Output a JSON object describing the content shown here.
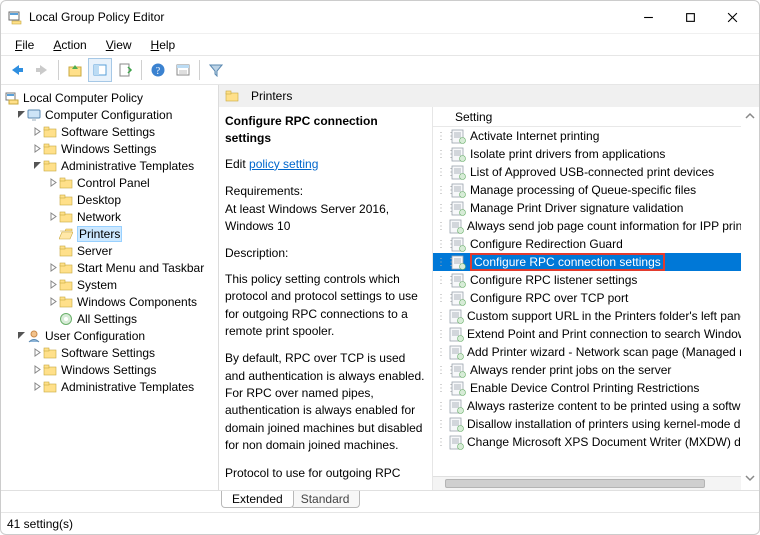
{
  "title": "Local Group Policy Editor",
  "menus": {
    "file": "File",
    "action": "Action",
    "view": "View",
    "help": "Help"
  },
  "tree": {
    "root": "Local Computer Policy",
    "cc": "Computer Configuration",
    "cc_software": "Software Settings",
    "cc_windows": "Windows Settings",
    "cc_admin": "Administrative Templates",
    "at_control_panel": "Control Panel",
    "at_desktop": "Desktop",
    "at_network": "Network",
    "at_printers": "Printers",
    "at_server": "Server",
    "at_start": "Start Menu and Taskbar",
    "at_system": "System",
    "at_wcomp": "Windows Components",
    "at_allsettings": "All Settings",
    "uc": "User Configuration",
    "uc_software": "Software Settings",
    "uc_windows": "Windows Settings",
    "uc_admin": "Administrative Templates"
  },
  "right_header": "Printers",
  "desc": {
    "title": "Configure RPC connection settings",
    "edit_prefix": "Edit ",
    "edit_link": "policy setting ",
    "reqs_heading": "Requirements:",
    "reqs_body": "At least Windows Server 2016, Windows 10",
    "desc_heading": "Description:",
    "p1": "This policy setting controls which protocol and protocol settings to use for outgoing RPC connections to a remote print spooler.",
    "p2": "By default, RPC over TCP is used and authentication is always enabled. For RPC over named pipes, authentication is always enabled for domain joined machines but disabled for non domain joined machines.",
    "p3": "Protocol to use for outgoing RPC"
  },
  "list_header": "Setting",
  "list": [
    "Activate Internet printing",
    "Isolate print drivers from applications",
    "List of Approved USB-connected print devices",
    "Manage processing of Queue-specific files",
    "Manage Print Driver signature validation",
    "Always send job page count information for IPP print",
    "Configure Redirection Guard",
    "Configure RPC connection settings",
    "Configure RPC listener settings",
    "Configure RPC over TCP port",
    "Custom support URL in the Printers folder's left pane",
    "Extend Point and Print connection to search Window",
    "Add Printer wizard - Network scan page (Managed ne",
    "Always render print jobs on the server",
    "Enable Device Control Printing Restrictions",
    "Always rasterize content to be printed using a softwa",
    "Disallow installation of printers using kernel-mode dr",
    "Change Microsoft XPS Document Writer (MXDW) def"
  ],
  "selected_index": 7,
  "tabs": {
    "extended": "Extended",
    "standard": "Standard"
  },
  "status": "41 setting(s)"
}
